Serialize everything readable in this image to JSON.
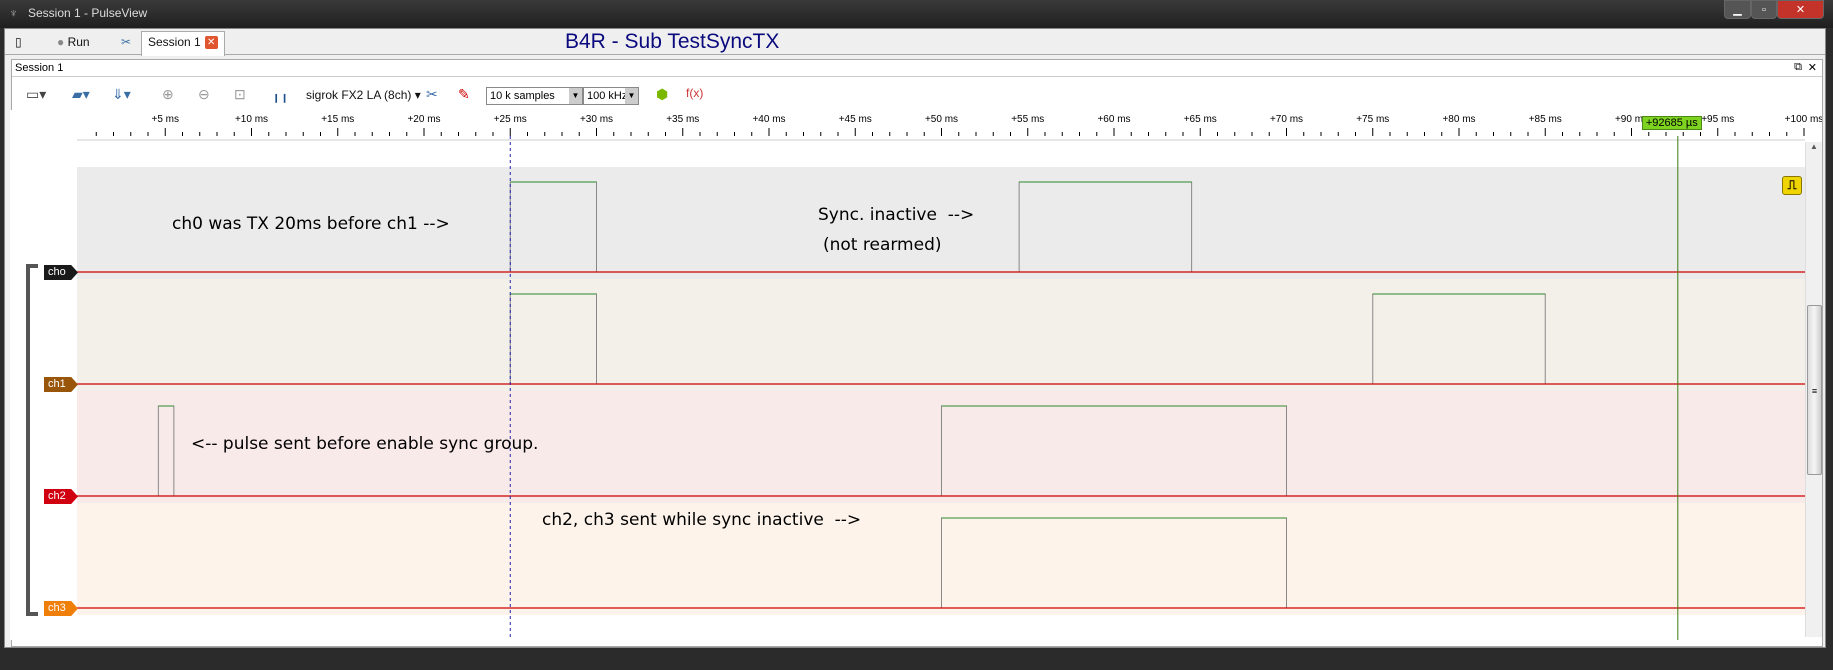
{
  "window": {
    "title": "Session 1 - PulseView",
    "controls": [
      "minimize",
      "maximize",
      "close"
    ]
  },
  "tabs": {
    "run_label": "Run",
    "session_tab": "Session 1",
    "heading": "B4R - Sub TestSyncTX"
  },
  "session": {
    "title": "Session 1"
  },
  "toolbar": {
    "device": "sigrok FX2 LA (8ch)",
    "samples": "10 k samples",
    "rate": "100 kHz"
  },
  "ruler": {
    "unit": "ms",
    "range_ms": [
      0,
      100
    ],
    "major_step_ms": 5,
    "minor_step_ms": 1,
    "cursor_label": "+92685 µs",
    "cursor_ms": 92.685,
    "marker_ms": 25
  },
  "channels": [
    {
      "name": "cho",
      "color": "#1a1a1a",
      "band": "#ebebeb",
      "high": [
        [
          25,
          30
        ],
        [
          54.5,
          64.5
        ]
      ]
    },
    {
      "name": "ch1",
      "color": "#99550a",
      "band": "#f3efe9",
      "high": [
        [
          25,
          30
        ],
        [
          75,
          85
        ]
      ]
    },
    {
      "name": "ch2",
      "color": "#d00010",
      "band": "#f9eaea",
      "high": [
        [
          4.6,
          5.5
        ],
        [
          50,
          70
        ]
      ]
    },
    {
      "name": "ch3",
      "color": "#f07f0a",
      "band": "#fdf3ea",
      "high": [
        [
          50,
          70
        ]
      ]
    }
  ],
  "notes": {
    "n1": "ch0 was TX 20ms before ch1 -->",
    "n2": "Sync. inactive  -->",
    "n3": "(not rearmed)",
    "n4": "<-- pulse sent before enable sync group.",
    "n5": "ch2, ch3 sent while sync inactive  -->"
  }
}
